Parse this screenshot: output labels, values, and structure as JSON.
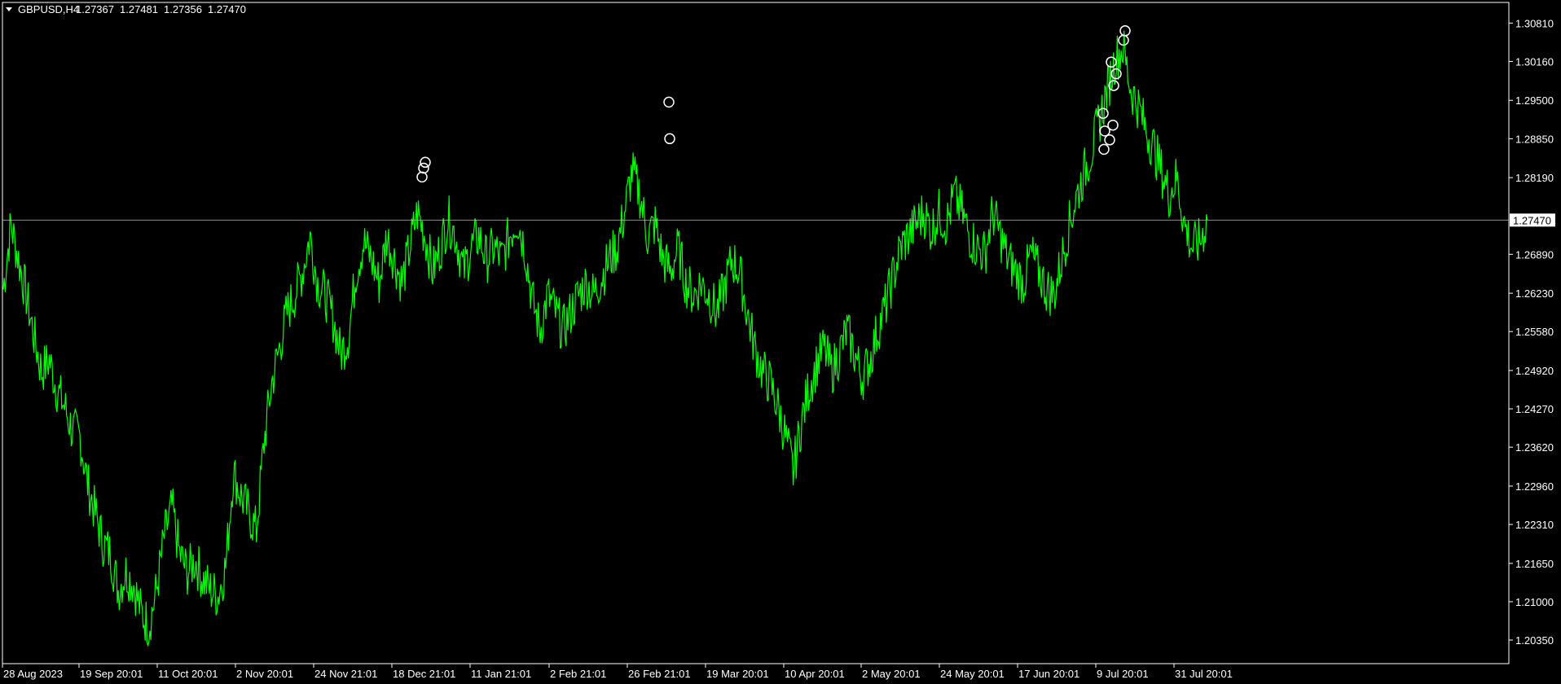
{
  "header": {
    "symbol": "GBPUSD,H4",
    "open": "1.27367",
    "high": "1.27481",
    "low": "1.27356",
    "close": "1.27470"
  },
  "colors": {
    "background": "#000000",
    "frame": "#ffffff",
    "series": "#00ff00",
    "bid_line": "#c0c0c0",
    "markers": "#ffffff"
  },
  "chart_data": {
    "type": "line",
    "symbol": "GBPUSD",
    "timeframe": "H4",
    "current_price": 1.2747,
    "current_price_label": "1.27470",
    "ylim": [
      1.1995,
      1.3116
    ],
    "y_ticks": [
      "1.30810",
      "1.30160",
      "1.29500",
      "1.28850",
      "1.28190",
      "1.27470",
      "1.26890",
      "1.26230",
      "1.25580",
      "1.24920",
      "1.24270",
      "1.23620",
      "1.22960",
      "1.22310",
      "1.21650",
      "1.21000",
      "1.20350"
    ],
    "x_ticks": [
      "28 Aug 2023",
      "19 Sep 20:01",
      "11 Oct 20:01",
      "2 Nov 20:01",
      "24 Nov 21:01",
      "18 Dec 21:01",
      "11 Jan 21:01",
      "2 Feb 21:01",
      "26 Feb 21:01",
      "19 Mar 20:01",
      "10 Apr 20:01",
      "2 May 20:01",
      "24 May 20:01",
      "17 Jun 20:01",
      "9 Jul 20:01",
      "31 Jul 20:01"
    ],
    "grid": false,
    "legend": "none",
    "series": [
      {
        "values": [
          1.263,
          1.274,
          1.268,
          1.262,
          1.255,
          1.249,
          1.251,
          1.246,
          1.243,
          1.239,
          1.238,
          1.23,
          1.225,
          1.22,
          1.218,
          1.212,
          1.215,
          1.213,
          1.208,
          1.206,
          1.212,
          1.221,
          1.226,
          1.218,
          1.215,
          1.217,
          1.214,
          1.212,
          1.211,
          1.216,
          1.232,
          1.228,
          1.225,
          1.222,
          1.237,
          1.247,
          1.253,
          1.259,
          1.262,
          1.266,
          1.272,
          1.264,
          1.262,
          1.258,
          1.252,
          1.255,
          1.266,
          1.271,
          1.268,
          1.264,
          1.272,
          1.268,
          1.264,
          1.27,
          1.276,
          1.272,
          1.266,
          1.27,
          1.275,
          1.272,
          1.266,
          1.27,
          1.272,
          1.268,
          1.27,
          1.268,
          1.272,
          1.275,
          1.27,
          1.261,
          1.256,
          1.262,
          1.259,
          1.256,
          1.259,
          1.262,
          1.264,
          1.262,
          1.265,
          1.268,
          1.27,
          1.276,
          1.283,
          1.279,
          1.272,
          1.274,
          1.268,
          1.266,
          1.27,
          1.264,
          1.262,
          1.264,
          1.262,
          1.259,
          1.263,
          1.268,
          1.266,
          1.259,
          1.253,
          1.249,
          1.247,
          1.243,
          1.238,
          1.232,
          1.24,
          1.246,
          1.25,
          1.253,
          1.249,
          1.252,
          1.256,
          1.252,
          1.248,
          1.251,
          1.256,
          1.26,
          1.265,
          1.27,
          1.272,
          1.274,
          1.276,
          1.273,
          1.276,
          1.274,
          1.279,
          1.276,
          1.272,
          1.27,
          1.269,
          1.276,
          1.272,
          1.268,
          1.266,
          1.264,
          1.269,
          1.266,
          1.263,
          1.262,
          1.268,
          1.274,
          1.279,
          1.283,
          1.287,
          1.292,
          1.297,
          1.302,
          1.304,
          1.297,
          1.294,
          1.29,
          1.287,
          1.283,
          1.279,
          1.282,
          1.274,
          1.27,
          1.271,
          1.2747
        ]
      }
    ],
    "markers": [
      1.282,
      1.2835,
      1.2845,
      1.2885,
      1.2947,
      1.2928,
      1.2898,
      1.2867,
      1.2883,
      1.2908,
      1.2975,
      1.2995,
      1.3015,
      1.3052,
      1.3068
    ]
  }
}
